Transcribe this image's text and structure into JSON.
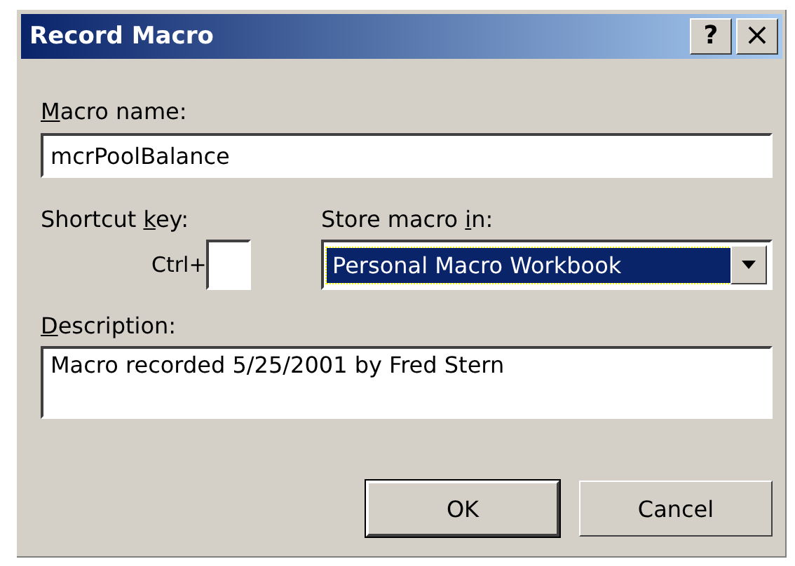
{
  "window": {
    "title": "Record Macro",
    "title_buttons": [
      {
        "kind": "help",
        "label": "?"
      },
      {
        "kind": "close",
        "label": "×"
      }
    ]
  },
  "macro_name": {
    "label": {
      "key": "M",
      "after": "acro name:"
    },
    "value": "mcrPoolBalance"
  },
  "shortcut_key": {
    "label": {
      "before": "Shortcut ",
      "key": "k",
      "after": "ey:"
    },
    "prefix": "Ctrl+"
  },
  "store_macro_in": {
    "label": {
      "before": "Store macro ",
      "key": "i",
      "after": "n:"
    },
    "value": "Personal Macro Workbook",
    "focused": true
  },
  "description": {
    "label": {
      "key": "D",
      "after": "escription:"
    },
    "value": "Macro recorded 5/25/2001 by Fred Stern"
  },
  "buttons": [
    {
      "label": "OK",
      "default": true
    },
    {
      "label": "Cancel",
      "default": false
    }
  ]
}
